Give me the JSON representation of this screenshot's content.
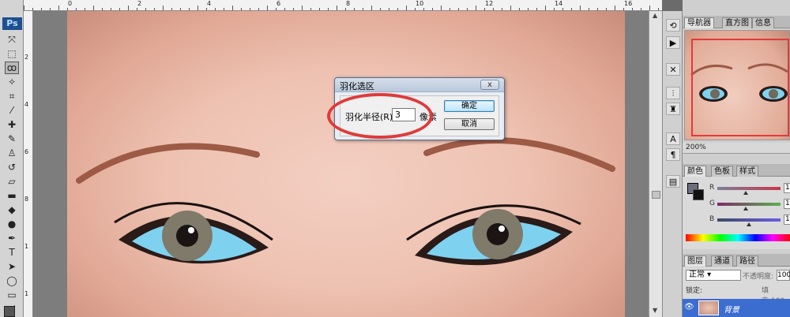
{
  "app": {
    "logo": "Ps"
  },
  "toolbox": {
    "tools": [
      {
        "name": "move-icon",
        "glyph": "⤧"
      },
      {
        "name": "marquee-icon",
        "glyph": "⬚"
      },
      {
        "name": "lasso-icon",
        "glyph": "ꝏ"
      },
      {
        "name": "magic-wand-icon",
        "glyph": "✧"
      },
      {
        "name": "crop-icon",
        "glyph": "⌗"
      },
      {
        "name": "eyedropper-icon",
        "glyph": "⁄"
      },
      {
        "name": "healing-brush-icon",
        "glyph": "✚"
      },
      {
        "name": "brush-icon",
        "glyph": "✎"
      },
      {
        "name": "clone-stamp-icon",
        "glyph": "♙"
      },
      {
        "name": "history-brush-icon",
        "glyph": "↺"
      },
      {
        "name": "eraser-icon",
        "glyph": "▱"
      },
      {
        "name": "gradient-icon",
        "glyph": "▬"
      },
      {
        "name": "blur-icon",
        "glyph": "◆"
      },
      {
        "name": "dodge-icon",
        "glyph": "●"
      },
      {
        "name": "pen-icon",
        "glyph": "✒"
      },
      {
        "name": "type-icon",
        "glyph": "T"
      },
      {
        "name": "path-select-icon",
        "glyph": "➤"
      },
      {
        "name": "shape-icon",
        "glyph": "◯"
      },
      {
        "name": "notes-icon",
        "glyph": "▭"
      },
      {
        "name": "eyedropper2-icon",
        "glyph": "⟋"
      }
    ]
  },
  "ruler": {
    "h_labels": [
      "0",
      "2",
      "4",
      "6",
      "8",
      "10",
      "12",
      "14",
      "16"
    ],
    "v_labels": [
      "2",
      "4",
      "6",
      "8",
      "1",
      "1"
    ]
  },
  "dialog": {
    "title": "羽化选区",
    "close_label": "x",
    "radius_label": "羽化半径(R):",
    "radius_value": "3",
    "unit": "像素",
    "ok_label": "确定",
    "cancel_label": "取消"
  },
  "navigator": {
    "tabs": [
      "导航器",
      "直方图",
      "信息"
    ],
    "zoom": "200%"
  },
  "color_panel": {
    "tabs": [
      "颜色",
      "色板",
      "样式"
    ],
    "channels": [
      {
        "label": "R",
        "value": "10",
        "knob_fraction": 0.45,
        "gradient": "#7a8099,#c9374a"
      },
      {
        "label": "G",
        "value": "10",
        "knob_fraction": 0.45,
        "gradient": "#7a2c66,#5fae54"
      },
      {
        "label": "B",
        "value": "11",
        "knob_fraction": 0.5,
        "gradient": "#3b4a64,#6b5ee0"
      }
    ]
  },
  "layers": {
    "tabs": [
      "图层",
      "通道",
      "路径"
    ],
    "blend_mode": "正常",
    "opacity_label": "不透明度:",
    "opacity_value": "100",
    "lock_label": "锁定:",
    "fill_label": "填充:",
    "fill_value": "100",
    "layer_name": "背景"
  },
  "colors": {
    "accent_blue": "#3b6cd0",
    "annotation_red": "#e03a3a",
    "foreground": "#6e6f7e",
    "background": "#111111"
  }
}
